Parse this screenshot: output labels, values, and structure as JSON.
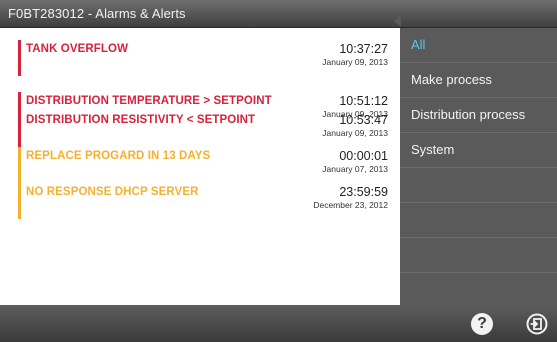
{
  "window": {
    "title": "F0BT283012 - Alarms & Alerts"
  },
  "alarms": [
    {
      "message": "TANK OVERFLOW",
      "time": "10:37:27",
      "date": "January 09, 2013",
      "severity_color": "#d7223b"
    },
    {
      "message": "DISTRIBUTION TEMPERATURE > SETPOINT",
      "time": "10:51:12",
      "date": "January 09, 2013",
      "severity_color": "#d7223b"
    },
    {
      "message": "DISTRIBUTION RESISTIVITY < SETPOINT",
      "time": "10:53:47",
      "date": "January 09, 2013",
      "severity_color": "#d7223b"
    },
    {
      "message": "REPLACE PROGARD IN 13 DAYS",
      "time": "00:00:01",
      "date": "January 07, 2013",
      "severity_color": "#f5b12e"
    },
    {
      "message": "NO RESPONSE DHCP SERVER",
      "time": "23:59:59",
      "date": "December 23, 2012",
      "severity_color": "#f5b12e"
    }
  ],
  "sidebar": {
    "items": [
      {
        "label": "All",
        "active": true
      },
      {
        "label": "Make process",
        "active": false
      },
      {
        "label": "Distribution process",
        "active": false
      },
      {
        "label": "System",
        "active": false
      }
    ]
  },
  "footer": {
    "help_symbol": "?",
    "help_icon": "question-circle-icon",
    "exit_icon": "exit-door-icon"
  },
  "colors": {
    "accent": "#55c8f0",
    "alarm": "#d7223b",
    "alert": "#f5b12e"
  }
}
